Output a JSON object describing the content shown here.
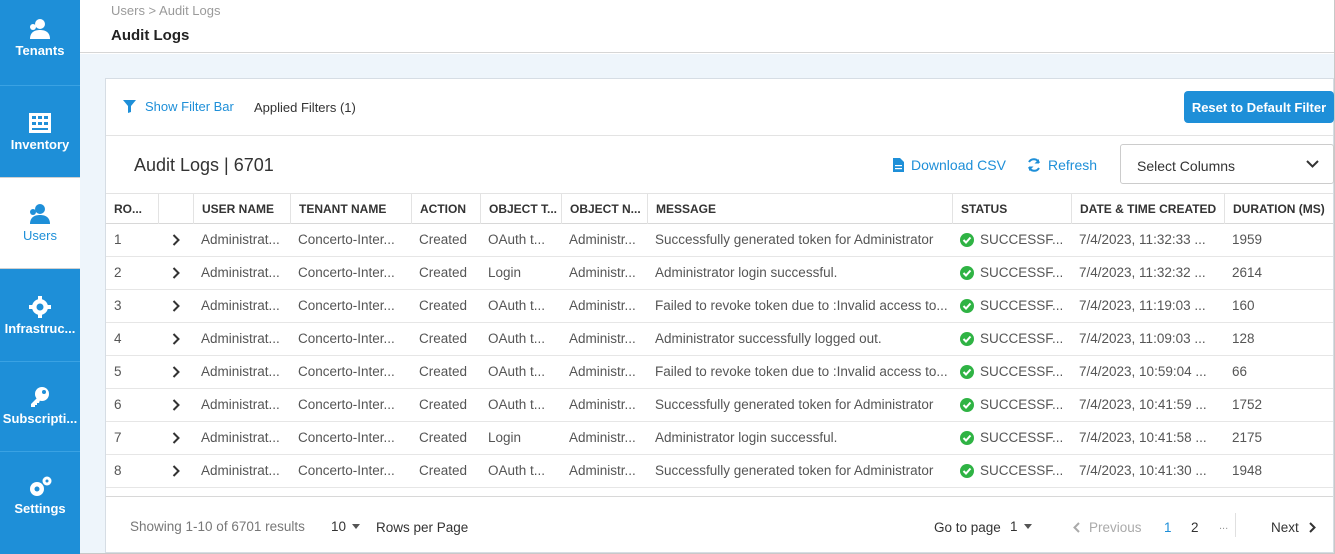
{
  "sidebar": {
    "items": [
      {
        "label": "Tenants",
        "icon": "users-icon"
      },
      {
        "label": "Inventory",
        "icon": "inventory-icon"
      },
      {
        "label": "Users",
        "icon": "user-icon"
      },
      {
        "label": "Infrastruc...",
        "icon": "gear-icon"
      },
      {
        "label": "Subscripti...",
        "icon": "key-icon"
      },
      {
        "label": "Settings",
        "icon": "gears-icon"
      }
    ],
    "active": "Users"
  },
  "header": {
    "breadcrumb": "Users > Audit Logs",
    "title": "Audit Logs"
  },
  "filterbar": {
    "show_filter_label": "Show Filter Bar",
    "applied_filters": "Applied Filters (1)",
    "reset_label": "Reset to Default Filter"
  },
  "toolbar": {
    "title": "Audit Logs | 6701",
    "download_label": "Download CSV",
    "refresh_label": "Refresh",
    "select_columns_label": "Select Columns"
  },
  "table": {
    "columns": [
      "RO...",
      "",
      "USER NAME",
      "TENANT NAME",
      "ACTION",
      "OBJECT T...",
      "OBJECT N...",
      "MESSAGE",
      "STATUS",
      "DATE & TIME CREATED",
      "DURATION (MS)"
    ],
    "rows": [
      {
        "row": "1",
        "user": "Administrat...",
        "tenant": "Concerto-Inter...",
        "action": "Created",
        "object_type": "OAuth t...",
        "object_name": "Administr...",
        "message": "Successfully generated token for Administrator",
        "status": "SUCCESSF...",
        "date": "7/4/2023, 11:32:33 ...",
        "duration": "1959"
      },
      {
        "row": "2",
        "user": "Administrat...",
        "tenant": "Concerto-Inter...",
        "action": "Created",
        "object_type": "Login",
        "object_name": "Administr...",
        "message": "Administrator login successful.",
        "status": "SUCCESSF...",
        "date": "7/4/2023, 11:32:32 ...",
        "duration": "2614"
      },
      {
        "row": "3",
        "user": "Administrat...",
        "tenant": "Concerto-Inter...",
        "action": "Created",
        "object_type": "OAuth t...",
        "object_name": "Administr...",
        "message": "Failed to revoke token due to :Invalid access to...",
        "status": "SUCCESSF...",
        "date": "7/4/2023, 11:19:03 ...",
        "duration": "160"
      },
      {
        "row": "4",
        "user": "Administrat...",
        "tenant": "Concerto-Inter...",
        "action": "Created",
        "object_type": "OAuth t...",
        "object_name": "Administr...",
        "message": "Administrator successfully logged out.",
        "status": "SUCCESSF...",
        "date": "7/4/2023, 11:09:03 ...",
        "duration": "128"
      },
      {
        "row": "5",
        "user": "Administrat...",
        "tenant": "Concerto-Inter...",
        "action": "Created",
        "object_type": "OAuth t...",
        "object_name": "Administr...",
        "message": "Failed to revoke token due to :Invalid access to...",
        "status": "SUCCESSF...",
        "date": "7/4/2023, 10:59:04 ...",
        "duration": "66"
      },
      {
        "row": "6",
        "user": "Administrat...",
        "tenant": "Concerto-Inter...",
        "action": "Created",
        "object_type": "OAuth t...",
        "object_name": "Administr...",
        "message": "Successfully generated token for Administrator",
        "status": "SUCCESSF...",
        "date": "7/4/2023, 10:41:59 ...",
        "duration": "1752"
      },
      {
        "row": "7",
        "user": "Administrat...",
        "tenant": "Concerto-Inter...",
        "action": "Created",
        "object_type": "Login",
        "object_name": "Administr...",
        "message": "Administrator login successful.",
        "status": "SUCCESSF...",
        "date": "7/4/2023, 10:41:58 ...",
        "duration": "2175"
      },
      {
        "row": "8",
        "user": "Administrat...",
        "tenant": "Concerto-Inter...",
        "action": "Created",
        "object_type": "OAuth t...",
        "object_name": "Administr...",
        "message": "Successfully generated token for Administrator",
        "status": "SUCCESSF...",
        "date": "7/4/2023, 10:41:30 ...",
        "duration": "1948"
      }
    ]
  },
  "footer": {
    "showing": "Showing 1-10 of 6701 results",
    "rows_per_page_value": "10",
    "rows_per_page_label": "Rows per Page",
    "goto_label": "Go to page",
    "goto_value": "1",
    "prev_label": "Previous",
    "pages": [
      "1",
      "2"
    ],
    "ellipsis": "...",
    "next_label": "Next"
  },
  "colors": {
    "accent": "#1e8fd8",
    "success": "#2fb344"
  }
}
